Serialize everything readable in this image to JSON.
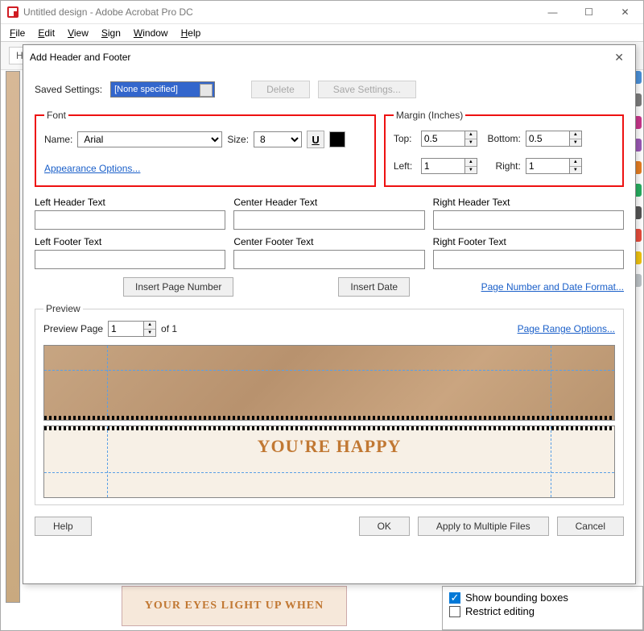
{
  "window": {
    "title": "Untitled design - Adobe Acrobat Pro DC",
    "min_icon": "—",
    "max_icon": "☐",
    "close_icon": "✕"
  },
  "menubar": {
    "file": "File",
    "edit": "Edit",
    "view": "View",
    "sign": "Sign",
    "window": "Window",
    "help": "Help"
  },
  "toolbar": {
    "home": "H"
  },
  "dialog": {
    "title": "Add Header and Footer",
    "close": "✕",
    "saved_settings_label": "Saved Settings:",
    "saved_settings_value": "[None specified]",
    "delete": "Delete",
    "save_settings": "Save Settings...",
    "font": {
      "legend": "Font",
      "name_label": "Name:",
      "name_value": "Arial",
      "size_label": "Size:",
      "size_value": "8",
      "underline": "U"
    },
    "margin": {
      "legend": "Margin (Inches)",
      "top_label": "Top:",
      "top_value": "0.5",
      "bottom_label": "Bottom:",
      "bottom_value": "0.5",
      "left_label": "Left:",
      "left_value": "1",
      "right_label": "Right:",
      "right_value": "1"
    },
    "appearance_link": "Appearance Options...",
    "headers": {
      "left_label": "Left Header Text",
      "center_label": "Center Header Text",
      "right_label": "Right Header Text",
      "left_value": "",
      "center_value": "",
      "right_value": ""
    },
    "footers": {
      "left_label": "Left Footer Text",
      "center_label": "Center Footer Text",
      "right_label": "Right Footer Text",
      "left_value": "",
      "center_value": "",
      "right_value": ""
    },
    "insert_page_number": "Insert Page Number",
    "insert_date": "Insert Date",
    "page_num_date_format": "Page Number and Date Format...",
    "preview": {
      "legend": "Preview",
      "page_label": "Preview Page",
      "page_value": "1",
      "of_label": "of 1",
      "range_link": "Page Range Options...",
      "footer_text": "YOU'RE HAPPY"
    },
    "buttons": {
      "help": "Help",
      "ok": "OK",
      "apply_multiple": "Apply to Multiple Files",
      "cancel": "Cancel"
    }
  },
  "bottom": {
    "doc_text": "YOUR EYES LIGHT UP WHEN",
    "show_bounding": "Show bounding boxes",
    "restrict_editing": "Restrict editing"
  }
}
